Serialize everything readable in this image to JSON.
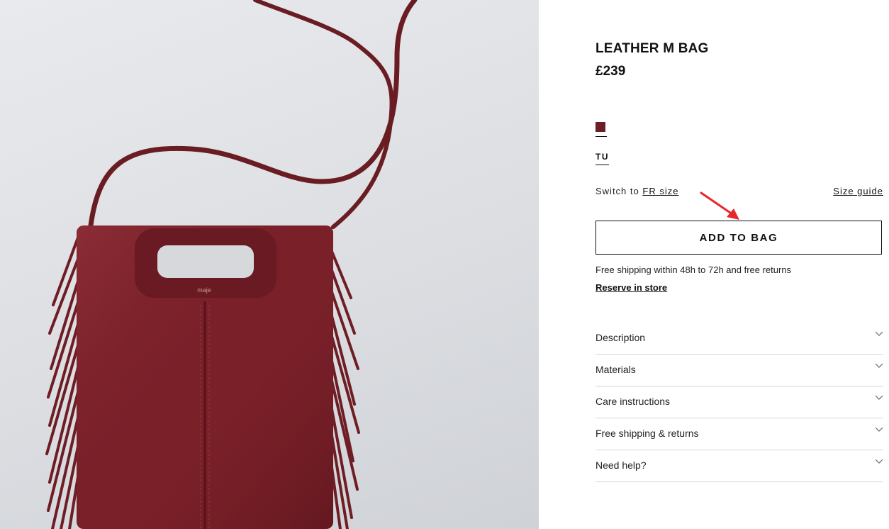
{
  "product": {
    "name": "LEATHER M BAG",
    "price": "£239",
    "brand_mark": "maje",
    "color_swatch": "#6b1f26",
    "size_option": "TU",
    "switch_prefix": "Switch to",
    "switch_link": "FR size",
    "size_guide": "Size guide",
    "add_to_bag": "ADD TO BAG",
    "shipping_note": "Free shipping within 48h to 72h and free returns",
    "reserve_link": "Reserve in store"
  },
  "accordion": [
    {
      "label": "Description"
    },
    {
      "label": "Materials"
    },
    {
      "label": "Care instructions"
    },
    {
      "label": "Free shipping & returns"
    },
    {
      "label": "Need help?"
    }
  ],
  "annotation": {
    "icon": "red-arrow-icon",
    "color": "#e8262c"
  }
}
